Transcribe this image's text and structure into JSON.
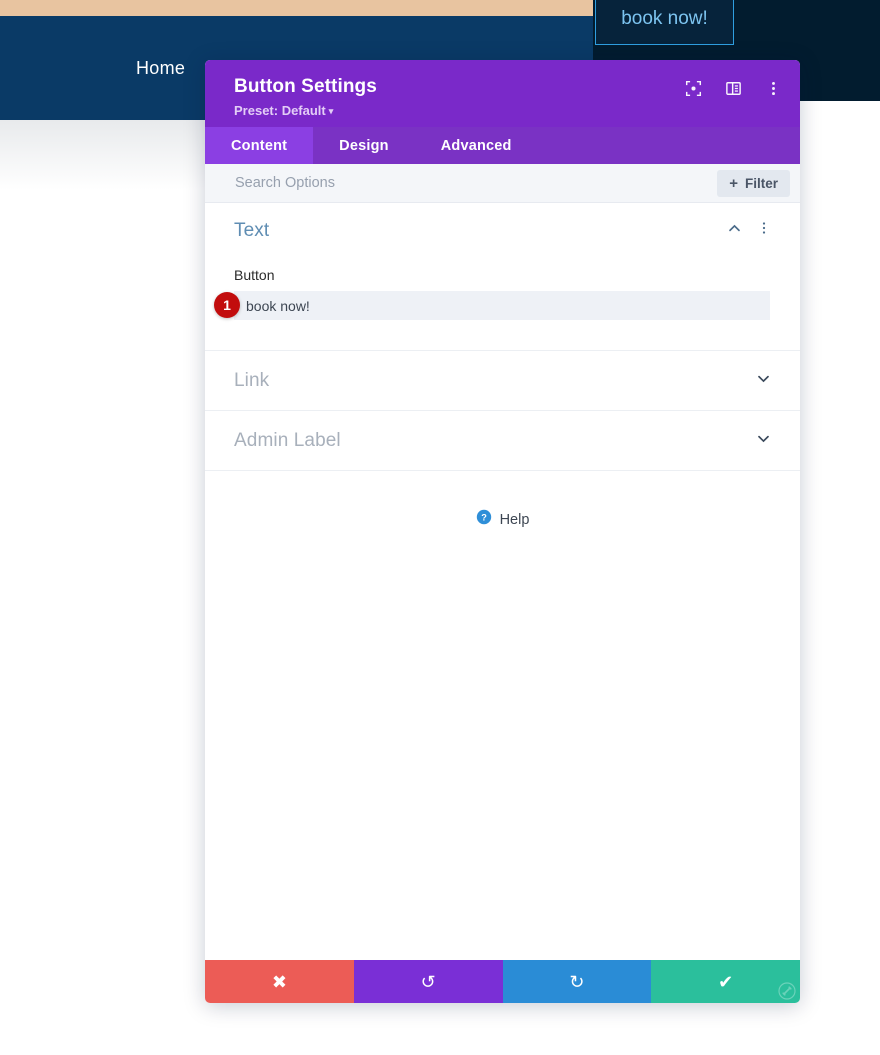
{
  "background": {
    "nav": {
      "home_label": "Home"
    },
    "cta": {
      "label": "book now!"
    },
    "colors": {
      "tan_strip": "#e8c4a0",
      "nav_bar": "#0a3a66",
      "dark_right": "#021c2f",
      "cta_border": "#2f9fe0",
      "cta_text": "#7cc4f0"
    }
  },
  "modal": {
    "title": "Button Settings",
    "preset": "Preset: Default",
    "preset_caret": "▾",
    "header_icons": [
      {
        "name": "focus-target-icon"
      },
      {
        "name": "layout-panel-icon"
      },
      {
        "name": "more-vertical-icon"
      }
    ],
    "tabs": [
      {
        "label": "Content",
        "active": true
      },
      {
        "label": "Design",
        "active": false
      },
      {
        "label": "Advanced",
        "active": false
      }
    ],
    "search": {
      "value": "",
      "placeholder": "Search Options"
    },
    "filter": {
      "label": "Filter",
      "plus": "+"
    },
    "sections": [
      {
        "title": "Text",
        "state": "expanded",
        "field_label": "Button",
        "field_value": "book now!",
        "badge": "1"
      },
      {
        "title": "Link",
        "state": "collapsed"
      },
      {
        "title": "Admin Label",
        "state": "collapsed"
      }
    ],
    "help": {
      "label": "Help"
    },
    "footer": [
      {
        "name": "cancel-button",
        "glyph": "✖",
        "color": "#ec5c56"
      },
      {
        "name": "undo-button",
        "glyph": "↺",
        "color": "#7a2fd6"
      },
      {
        "name": "redo-button",
        "glyph": "↻",
        "color": "#2a8cd6"
      },
      {
        "name": "save-button",
        "glyph": "✔",
        "color": "#2bbf9c"
      }
    ],
    "colors": {
      "header_purple": "#7a29c9",
      "tab_bar": "#7a32c4",
      "tab_active": "#8b3fe3",
      "section_title_open": "#5f8db3",
      "section_title_closed": "#a8b0bb",
      "badge_red": "#c20d0d"
    }
  }
}
